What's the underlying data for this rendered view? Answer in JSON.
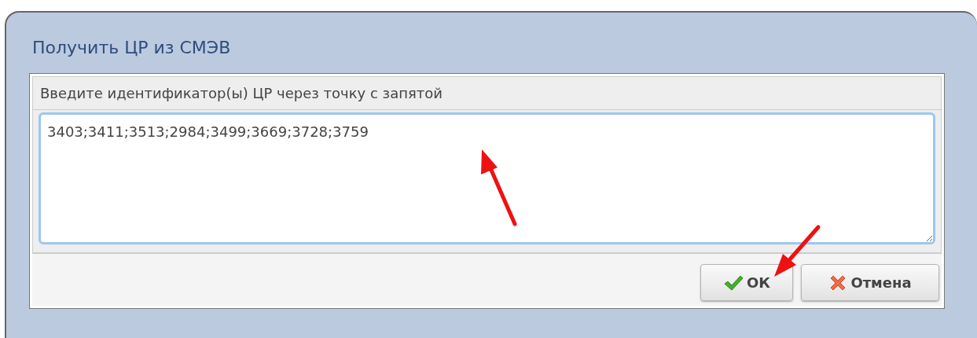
{
  "dialog": {
    "title": "Получить ЦР из СМЭВ"
  },
  "field": {
    "label": "Введите идентификатор(ы) ЦР через точку с запятой",
    "value": "3403;3411;3513;2984;3499;3669;3728;3759"
  },
  "buttons": [
    {
      "kind": "ok",
      "label": "ОК"
    },
    {
      "kind": "cancel",
      "label": "Отмена"
    }
  ]
}
